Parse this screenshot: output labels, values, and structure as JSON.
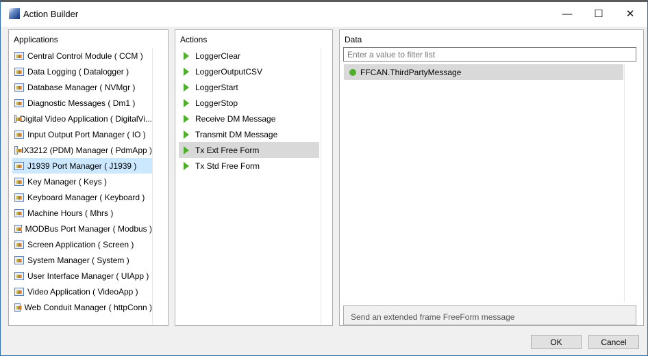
{
  "window": {
    "title": "Action Builder",
    "minimize": "—",
    "maximize": "☐",
    "close": "✕"
  },
  "applications": {
    "label": "Applications",
    "selected_index": 7,
    "items": [
      "Central Control Module  ( CCM )",
      "Data Logging  ( Datalogger )",
      "Database Manager  ( NVMgr )",
      "Diagnostic Messages  ( Dm1 )",
      "Digital Video Application  ( DigitalVi...",
      "Input Output Port Manager  ( IO )",
      "IX3212 (PDM) Manager  ( PdmApp )",
      "J1939 Port Manager  ( J1939 )",
      "Key Manager  ( Keys )",
      "Keyboard Manager  ( Keyboard )",
      "Machine Hours  ( Mhrs )",
      "MODBus Port Manager  ( Modbus )",
      "Screen Application  ( Screen )",
      "System Manager  ( System )",
      "User Interface Manager  ( UIApp )",
      "Video Application  ( VideoApp )",
      "Web Conduit Manager  ( httpConn )"
    ]
  },
  "actions": {
    "label": "Actions",
    "selected_index": 6,
    "items": [
      "LoggerClear",
      "LoggerOutputCSV",
      "LoggerStart",
      "LoggerStop",
      "Receive DM Message",
      "Transmit DM Message",
      "Tx Ext Free Form",
      "Tx Std Free Form"
    ]
  },
  "data": {
    "label": "Data",
    "filter_placeholder": "Enter a value to filter list",
    "filter_value": "",
    "items": [
      "FFCAN.ThirdPartyMessage"
    ],
    "description": "Send an extended frame FreeForm message"
  },
  "buttons": {
    "ok": "OK",
    "cancel": "Cancel"
  },
  "colors": {
    "selection_blue": "#cce8ff",
    "selection_grey": "#d9d9d9",
    "action_icon": "#4fae2c"
  }
}
